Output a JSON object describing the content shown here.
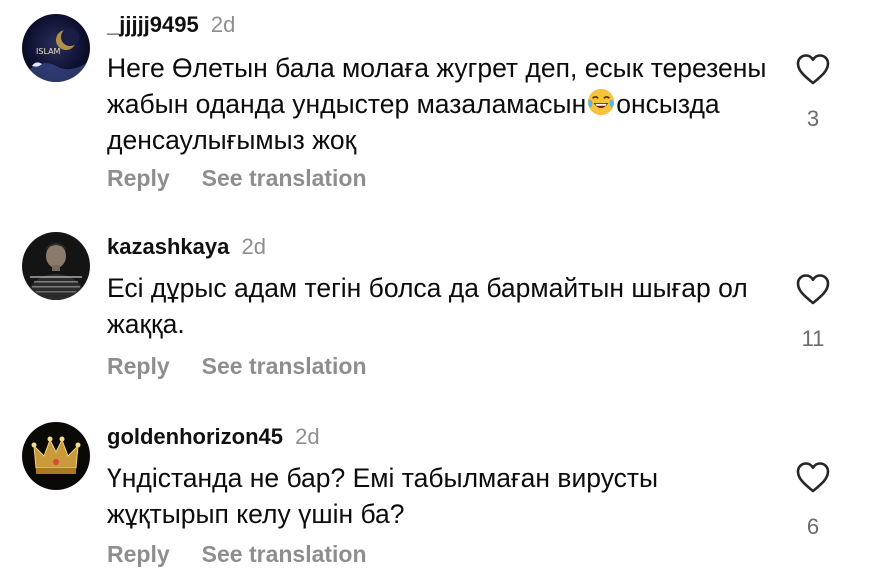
{
  "comments": [
    {
      "username": "_jjjjj9495",
      "time": "2d",
      "text_before_emoji": "Неге Өлетын бала молаға жугрет деп, есык терезены жабын оданда ундыстер мазаламасын",
      "emoji": "face-with-tears-of-joy",
      "text_after_emoji": "онсызда денсаулығымыз жоқ",
      "reply_label": "Reply",
      "translate_label": "See translation",
      "likes": "3",
      "avatar_text": "ISLAM"
    },
    {
      "username": "kazashkaya",
      "time": "2d",
      "text": "Есі дұрыс адам тегін болса да бармайтын шығар ол жаққа.",
      "reply_label": "Reply",
      "translate_label": "See translation",
      "likes": "11"
    },
    {
      "username": "goldenhorizon45",
      "time": "2d",
      "text": "Үндістанда не бар? Емі табылмаған вирусты жұқтырып келу үшін ба?",
      "reply_label": "Reply",
      "translate_label": "See translation",
      "likes": "6"
    }
  ],
  "colors": {
    "muted": "#8e8e8e",
    "text": "#0c0c0c",
    "heart_outline": "#262626"
  }
}
